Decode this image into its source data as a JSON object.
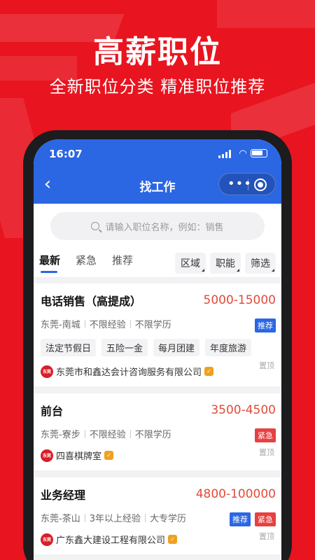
{
  "promo": {
    "headline": "高薪职位",
    "subheadline": "全新职位分类 精准职位推荐"
  },
  "status_bar": {
    "time": "16:07"
  },
  "nav": {
    "title": "找工作",
    "more": "•••"
  },
  "search": {
    "placeholder": "请输入职位名称，例如：销售"
  },
  "tabs": [
    {
      "label": "最新",
      "active": true
    },
    {
      "label": "紧急",
      "active": false
    },
    {
      "label": "推荐",
      "active": false
    }
  ],
  "filters": [
    "区域",
    "职能",
    "筛选"
  ],
  "jobs": [
    {
      "title": "电话销售（高提成）",
      "salary": "5000-15000",
      "location": "东莞-南城",
      "experience": "不限经验",
      "education": "不限学历",
      "tags": [
        "法定节假日",
        "五险一金",
        "每月团建",
        "年度旅游"
      ],
      "badges": [
        "推荐"
      ],
      "company": "东莞市和鑫达会计咨询服务有限公司",
      "logo_text": "东莞",
      "pinned": "置顶"
    },
    {
      "title": "前台",
      "salary": "3500-4500",
      "location": "东莞-寮步",
      "experience": "不限经验",
      "education": "不限学历",
      "tags": [],
      "badges": [
        "紧急"
      ],
      "company": "四喜棋牌室",
      "logo_text": "东莞",
      "pinned": "置顶"
    },
    {
      "title": "业务经理",
      "salary": "4800-100000",
      "location": "东莞-茶山",
      "experience": "3年以上经验",
      "education": "大专学历",
      "tags": [],
      "badges": [
        "推荐",
        "紧急"
      ],
      "company": "广东鑫大建设工程有限公司",
      "logo_text": "东莞",
      "pinned": "置顶"
    }
  ],
  "colors": {
    "background": "#e8141f",
    "appbar": "#2b66e3",
    "salary": "#e24a3a",
    "badge_recommend": "#2b66e3",
    "badge_urgent": "#e84040"
  }
}
